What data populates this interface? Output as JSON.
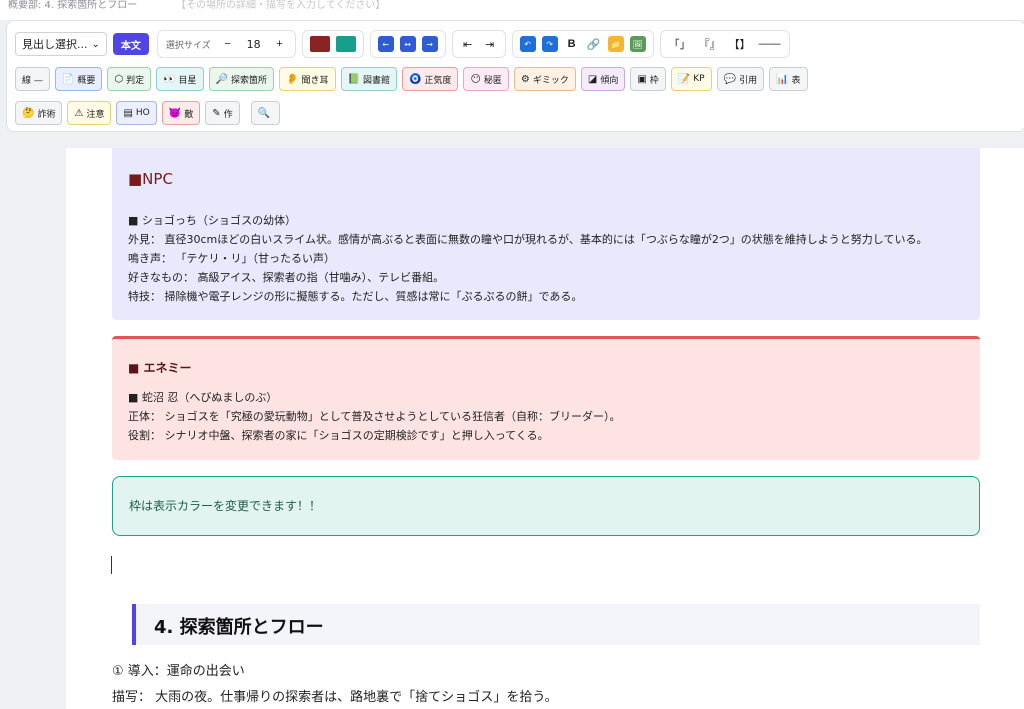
{
  "header": {
    "breadcrumb": "概要部: 4. 探索箇所とフロー",
    "ghost_text": "【その場所の詳細・描写を入力してください】"
  },
  "toolbar": {
    "heading_select": "見出し選択...",
    "body_button": "本文",
    "size_label": "選択サイズ",
    "size_minus": "−",
    "size_value": "18",
    "size_plus": "+",
    "swatches": {
      "red": "#8b2323",
      "teal": "#16a08c"
    },
    "align": [
      "←",
      "↔",
      "→"
    ],
    "indent": [
      "⇤",
      "⇥"
    ],
    "format": {
      "undo": "↶",
      "redo": "↷",
      "bold": "B",
      "link": "🔗",
      "folder": "📁",
      "image": "🖼"
    },
    "brackets": [
      "「」",
      "『』",
      "【】",
      "——"
    ],
    "row2": [
      {
        "icon": "",
        "label": "線 —"
      },
      {
        "icon": "📄",
        "label": "概要"
      },
      {
        "icon": "⬡",
        "label": "判定"
      },
      {
        "icon": "👀",
        "label": "目星"
      },
      {
        "icon": "🔎",
        "label": "探索箇所"
      },
      {
        "icon": "👂",
        "label": "聞き耳"
      },
      {
        "icon": "📗",
        "label": "図書館"
      },
      {
        "icon": "🧿",
        "label": "正気度"
      },
      {
        "icon": "😶",
        "label": "秘匿"
      },
      {
        "icon": "⚙",
        "label": "ギミック"
      },
      {
        "icon": "◪",
        "label": "傾向"
      },
      {
        "icon": "▣",
        "label": "枠"
      },
      {
        "icon": "📝",
        "label": "KP"
      },
      {
        "icon": "💬",
        "label": "引用"
      },
      {
        "icon": "📊",
        "label": "表"
      }
    ],
    "row3": [
      {
        "icon": "🤔",
        "label": "詐術"
      },
      {
        "icon": "⚠",
        "label": "注意"
      },
      {
        "icon": "▤",
        "label": "HO"
      },
      {
        "icon": "👿",
        "label": "敵"
      },
      {
        "icon": "✎",
        "label": "作"
      }
    ],
    "search_icon": "🔍"
  },
  "npc": {
    "title": "■NPC",
    "lines": [
      "■ ショゴっち（ショゴスの幼体）",
      "外見： 直径30cmほどの白いスライム状。感情が高ぶると表面に無数の瞳や口が現れるが、基本的には「つぶらな瞳が2つ」の状態を維持しようと努力している。",
      "鳴き声： 「テケリ・リ」（甘ったるい声）",
      "好きなもの： 高級アイス、探索者の指（甘噛み）、テレビ番組。",
      "特技： 掃除機や電子レンジの形に擬態する。ただし、質感は常に「ぷるぷるの餅」である。"
    ]
  },
  "enemy": {
    "title": "■ エネミー",
    "lines": [
      "■ 蛇沼 忍（へびぬましのぶ）",
      "正体： ショゴスを「究極の愛玩動物」として普及させようとしている狂信者（自称：ブリーダー）。",
      "役割： シナリオ中盤、探索者の家に「ショゴスの定期検診です」と押し入ってくる。"
    ]
  },
  "note": {
    "text": "枠は表示カラーを変更できます！！"
  },
  "section": {
    "title": "4. 探索箇所とフロー"
  },
  "body": {
    "line1": "① 導入：運命の出会い",
    "line2": "描写： 大雨の夜。仕事帰りの探索者は、路地裏で「捨てショゴス」を拾う。"
  }
}
